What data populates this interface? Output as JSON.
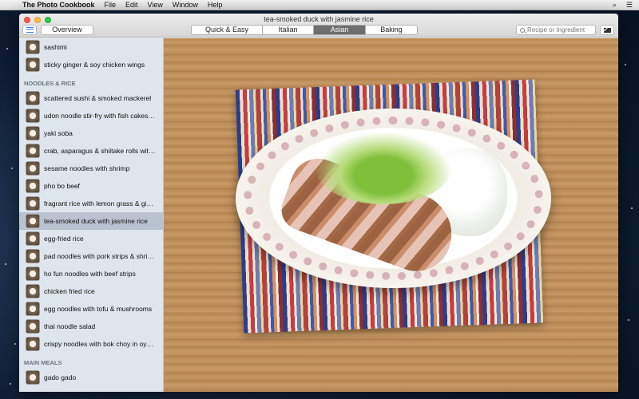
{
  "menubar": {
    "app_name": "The Photo Cookbook",
    "items": [
      "File",
      "Edit",
      "View",
      "Window",
      "Help"
    ]
  },
  "window": {
    "title": "tea-smoked duck with jasmine rice"
  },
  "toolbar": {
    "overview_label": "Overview",
    "segments": [
      {
        "label": "Quick & Easy",
        "active": false
      },
      {
        "label": "Italian",
        "active": false
      },
      {
        "label": "Asian",
        "active": true
      },
      {
        "label": "Baking",
        "active": false
      }
    ],
    "search_placeholder": "Recipe or Ingredient"
  },
  "sidebar": {
    "top_items": [
      {
        "label": "sashimi"
      },
      {
        "label": "sticky ginger & soy chicken wings"
      }
    ],
    "section_noodles": "NOODLES & RICE",
    "noodle_items": [
      {
        "label": "scattered sushi & smoked mackerel"
      },
      {
        "label": "udon noodle stir-fry with fish cakes &..."
      },
      {
        "label": "yaki soba"
      },
      {
        "label": "crab, asparagus & shiitake rolls with..."
      },
      {
        "label": "sesame noodles with shrimp"
      },
      {
        "label": "pho bo beef"
      },
      {
        "label": "fragrant rice with lemon grass & ginger"
      },
      {
        "label": "tea-smoked duck with jasmine rice",
        "selected": true
      },
      {
        "label": "egg-fried rice"
      },
      {
        "label": "pad noodles with pork strips & shrimp"
      },
      {
        "label": "ho fun noodles with beef strips"
      },
      {
        "label": "chicken fried rice"
      },
      {
        "label": "egg noodles with tofu & mushrooms"
      },
      {
        "label": "thai noodle salad"
      },
      {
        "label": "crispy noodles with bok choy in oyste..."
      }
    ],
    "section_main": "MAIN MEALS",
    "main_items": [
      {
        "label": "gado gado"
      }
    ]
  },
  "colors": {
    "selected_row": "#b9c3cf",
    "sidebar_bg": "#dfe5ec",
    "active_segment": "#6e6e6e"
  }
}
